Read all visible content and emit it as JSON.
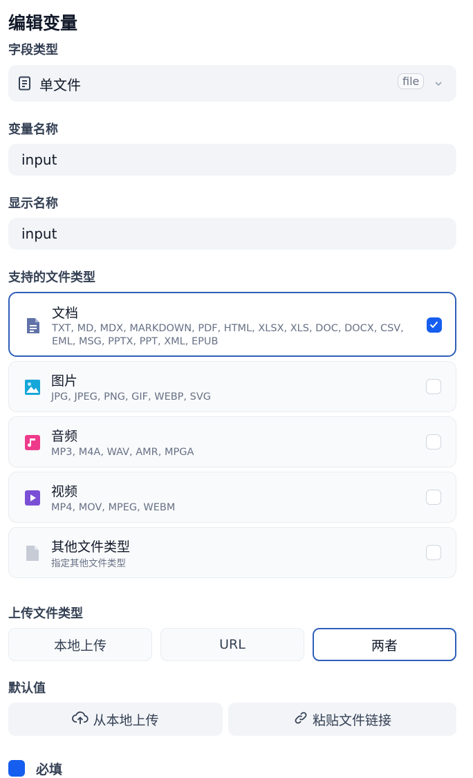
{
  "page_title": "编辑变量",
  "field_type": {
    "label": "字段类型",
    "value": "单文件",
    "badge": "file",
    "icon": "document-icon"
  },
  "variable_name": {
    "label": "变量名称",
    "value": "input"
  },
  "display_name": {
    "label": "显示名称",
    "value": "input"
  },
  "file_types": {
    "label": "支持的文件类型",
    "items": [
      {
        "name": "文档",
        "exts": "TXT, MD, MDX, MARKDOWN, PDF, HTML, XLSX, XLS, DOC, DOCX, CSV, EML, MSG, PPTX, PPT, XML, EPUB",
        "checked": true,
        "color": "#6172a8"
      },
      {
        "name": "图片",
        "exts": "JPG, JPEG, PNG, GIF, WEBP, SVG",
        "checked": false,
        "color": "#17a6d9"
      },
      {
        "name": "音频",
        "exts": "MP3, M4A, WAV, AMR, MPGA",
        "checked": false,
        "color": "#ee3a8a"
      },
      {
        "name": "视频",
        "exts": "MP4, MOV, MPEG, WEBM",
        "checked": false,
        "color": "#7a4fd6"
      },
      {
        "name": "其他文件类型",
        "exts": "指定其他文件类型",
        "checked": false,
        "color": "#c6cbd6"
      }
    ]
  },
  "upload_method": {
    "label": "上传文件类型",
    "options": [
      "本地上传",
      "URL",
      "两者"
    ],
    "selected": "两者"
  },
  "default_value": {
    "label": "默认值",
    "upload_local": "从本地上传",
    "paste_link": "粘贴文件链接"
  },
  "required": {
    "label": "必填",
    "checked": true
  },
  "accent_color": "#155eef"
}
